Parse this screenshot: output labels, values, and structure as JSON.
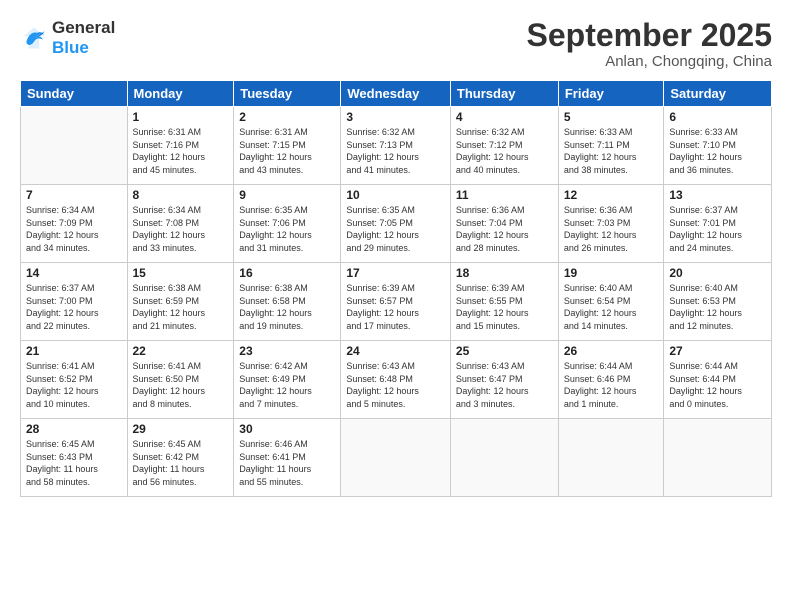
{
  "header": {
    "logo_line1": "General",
    "logo_line2": "Blue",
    "month": "September 2025",
    "location": "Anlan, Chongqing, China"
  },
  "weekdays": [
    "Sunday",
    "Monday",
    "Tuesday",
    "Wednesday",
    "Thursday",
    "Friday",
    "Saturday"
  ],
  "weeks": [
    [
      {
        "day": "",
        "info": ""
      },
      {
        "day": "1",
        "info": "Sunrise: 6:31 AM\nSunset: 7:16 PM\nDaylight: 12 hours\nand 45 minutes."
      },
      {
        "day": "2",
        "info": "Sunrise: 6:31 AM\nSunset: 7:15 PM\nDaylight: 12 hours\nand 43 minutes."
      },
      {
        "day": "3",
        "info": "Sunrise: 6:32 AM\nSunset: 7:13 PM\nDaylight: 12 hours\nand 41 minutes."
      },
      {
        "day": "4",
        "info": "Sunrise: 6:32 AM\nSunset: 7:12 PM\nDaylight: 12 hours\nand 40 minutes."
      },
      {
        "day": "5",
        "info": "Sunrise: 6:33 AM\nSunset: 7:11 PM\nDaylight: 12 hours\nand 38 minutes."
      },
      {
        "day": "6",
        "info": "Sunrise: 6:33 AM\nSunset: 7:10 PM\nDaylight: 12 hours\nand 36 minutes."
      }
    ],
    [
      {
        "day": "7",
        "info": "Sunrise: 6:34 AM\nSunset: 7:09 PM\nDaylight: 12 hours\nand 34 minutes."
      },
      {
        "day": "8",
        "info": "Sunrise: 6:34 AM\nSunset: 7:08 PM\nDaylight: 12 hours\nand 33 minutes."
      },
      {
        "day": "9",
        "info": "Sunrise: 6:35 AM\nSunset: 7:06 PM\nDaylight: 12 hours\nand 31 minutes."
      },
      {
        "day": "10",
        "info": "Sunrise: 6:35 AM\nSunset: 7:05 PM\nDaylight: 12 hours\nand 29 minutes."
      },
      {
        "day": "11",
        "info": "Sunrise: 6:36 AM\nSunset: 7:04 PM\nDaylight: 12 hours\nand 28 minutes."
      },
      {
        "day": "12",
        "info": "Sunrise: 6:36 AM\nSunset: 7:03 PM\nDaylight: 12 hours\nand 26 minutes."
      },
      {
        "day": "13",
        "info": "Sunrise: 6:37 AM\nSunset: 7:01 PM\nDaylight: 12 hours\nand 24 minutes."
      }
    ],
    [
      {
        "day": "14",
        "info": "Sunrise: 6:37 AM\nSunset: 7:00 PM\nDaylight: 12 hours\nand 22 minutes."
      },
      {
        "day": "15",
        "info": "Sunrise: 6:38 AM\nSunset: 6:59 PM\nDaylight: 12 hours\nand 21 minutes."
      },
      {
        "day": "16",
        "info": "Sunrise: 6:38 AM\nSunset: 6:58 PM\nDaylight: 12 hours\nand 19 minutes."
      },
      {
        "day": "17",
        "info": "Sunrise: 6:39 AM\nSunset: 6:57 PM\nDaylight: 12 hours\nand 17 minutes."
      },
      {
        "day": "18",
        "info": "Sunrise: 6:39 AM\nSunset: 6:55 PM\nDaylight: 12 hours\nand 15 minutes."
      },
      {
        "day": "19",
        "info": "Sunrise: 6:40 AM\nSunset: 6:54 PM\nDaylight: 12 hours\nand 14 minutes."
      },
      {
        "day": "20",
        "info": "Sunrise: 6:40 AM\nSunset: 6:53 PM\nDaylight: 12 hours\nand 12 minutes."
      }
    ],
    [
      {
        "day": "21",
        "info": "Sunrise: 6:41 AM\nSunset: 6:52 PM\nDaylight: 12 hours\nand 10 minutes."
      },
      {
        "day": "22",
        "info": "Sunrise: 6:41 AM\nSunset: 6:50 PM\nDaylight: 12 hours\nand 8 minutes."
      },
      {
        "day": "23",
        "info": "Sunrise: 6:42 AM\nSunset: 6:49 PM\nDaylight: 12 hours\nand 7 minutes."
      },
      {
        "day": "24",
        "info": "Sunrise: 6:43 AM\nSunset: 6:48 PM\nDaylight: 12 hours\nand 5 minutes."
      },
      {
        "day": "25",
        "info": "Sunrise: 6:43 AM\nSunset: 6:47 PM\nDaylight: 12 hours\nand 3 minutes."
      },
      {
        "day": "26",
        "info": "Sunrise: 6:44 AM\nSunset: 6:46 PM\nDaylight: 12 hours\nand 1 minute."
      },
      {
        "day": "27",
        "info": "Sunrise: 6:44 AM\nSunset: 6:44 PM\nDaylight: 12 hours\nand 0 minutes."
      }
    ],
    [
      {
        "day": "28",
        "info": "Sunrise: 6:45 AM\nSunset: 6:43 PM\nDaylight: 11 hours\nand 58 minutes."
      },
      {
        "day": "29",
        "info": "Sunrise: 6:45 AM\nSunset: 6:42 PM\nDaylight: 11 hours\nand 56 minutes."
      },
      {
        "day": "30",
        "info": "Sunrise: 6:46 AM\nSunset: 6:41 PM\nDaylight: 11 hours\nand 55 minutes."
      },
      {
        "day": "",
        "info": ""
      },
      {
        "day": "",
        "info": ""
      },
      {
        "day": "",
        "info": ""
      },
      {
        "day": "",
        "info": ""
      }
    ]
  ]
}
